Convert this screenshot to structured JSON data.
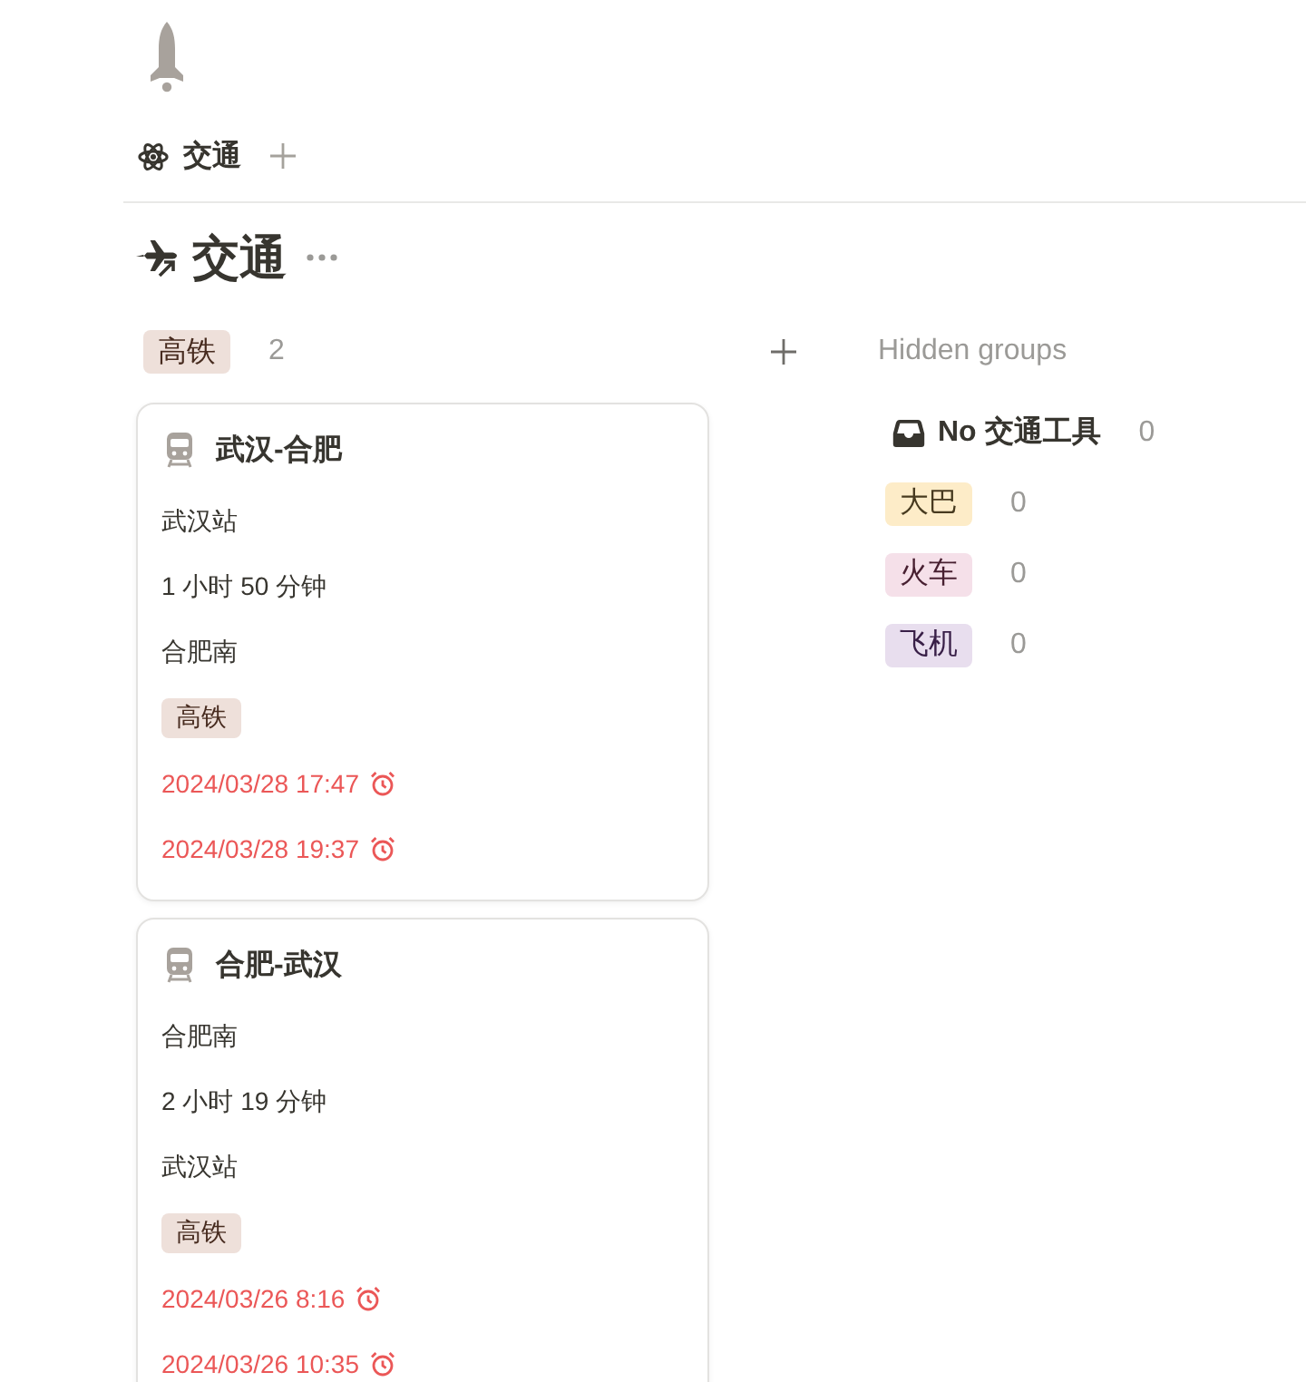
{
  "page": {
    "tabs": [
      {
        "label": "交通",
        "selected": true
      }
    ],
    "title": "交通"
  },
  "board": {
    "groups": [
      {
        "label": "高铁",
        "color": "#eee0da",
        "count": "2",
        "cards": [
          {
            "title": "武汉-合肥",
            "properties": [
              {
                "kind": "text",
                "text": "武汉站"
              },
              {
                "kind": "text",
                "text": "1 小时 50 分钟"
              },
              {
                "kind": "text",
                "text": "合肥南"
              },
              {
                "kind": "tag",
                "text": "高铁",
                "color": "#eee0da"
              },
              {
                "kind": "date",
                "text": "2024/03/28 17:47",
                "overdue": true,
                "reminder": true
              },
              {
                "kind": "date",
                "text": "2024/03/28 19:37",
                "overdue": true,
                "reminder": true
              }
            ]
          },
          {
            "title": "合肥-武汉",
            "properties": [
              {
                "kind": "text",
                "text": "合肥南"
              },
              {
                "kind": "text",
                "text": "2 小时 19 分钟"
              },
              {
                "kind": "text",
                "text": "武汉站"
              },
              {
                "kind": "tag",
                "text": "高铁",
                "color": "#eee0da"
              },
              {
                "kind": "date",
                "text": "2024/03/26 8:16",
                "overdue": true,
                "reminder": true
              },
              {
                "kind": "date",
                "text": "2024/03/26 10:35",
                "overdue": true,
                "reminder": true
              }
            ]
          }
        ]
      }
    ],
    "hidden_groups": {
      "heading": "Hidden groups",
      "items": [
        {
          "kind": "empty",
          "label": "No 交通工具",
          "count": "0"
        },
        {
          "kind": "tag",
          "label": "大巴",
          "color": "#fdecc8",
          "count": "0"
        },
        {
          "kind": "tag",
          "label": "火车",
          "color": "#f5e0e9",
          "count": "0"
        },
        {
          "kind": "tag",
          "label": "飞机",
          "color": "#e8deee",
          "count": "0"
        }
      ]
    }
  }
}
